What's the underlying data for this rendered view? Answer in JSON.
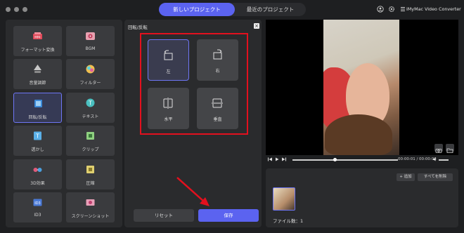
{
  "tabs": {
    "new_project": "新しいプロジェクト",
    "recent_projects": "最近のプロジェクト"
  },
  "app": {
    "title": "iMyMac Video Converter"
  },
  "tools": [
    {
      "label": "フォーマット変換",
      "icon": "convert-icon"
    },
    {
      "label": "BGM",
      "icon": "music-icon"
    },
    {
      "label": "音量調節",
      "icon": "volume-adjust-icon"
    },
    {
      "label": "フィルター",
      "icon": "filter-icon"
    },
    {
      "label": "回転/反転",
      "icon": "rotate-icon",
      "active": true
    },
    {
      "label": "テキスト",
      "icon": "text-icon"
    },
    {
      "label": "透かし",
      "icon": "watermark-icon"
    },
    {
      "label": "クリップ",
      "icon": "clip-icon"
    },
    {
      "label": "3D効果",
      "icon": "3d-glasses-icon"
    },
    {
      "label": "圧縮",
      "icon": "compress-icon"
    },
    {
      "label": "ID3",
      "icon": "id3-icon"
    },
    {
      "label": "スクリーンショット",
      "icon": "screenshot-icon"
    }
  ],
  "rotate_panel": {
    "title": "回転/反転",
    "close": "×",
    "options": {
      "left": "左",
      "right": "右",
      "horizontal": "水平",
      "vertical": "垂直"
    },
    "reset": "リセット",
    "save": "保存"
  },
  "player": {
    "time": "00:00:01 / 00:00:03"
  },
  "file_list": {
    "add": "+ 追加",
    "delete_all": "すべてを削除",
    "count": "ファイル数：1"
  },
  "colors": {
    "accent": "#5b63f0",
    "highlight_box": "#e3101e",
    "panel": "#2a2b2d",
    "background": "#1e1f21"
  }
}
